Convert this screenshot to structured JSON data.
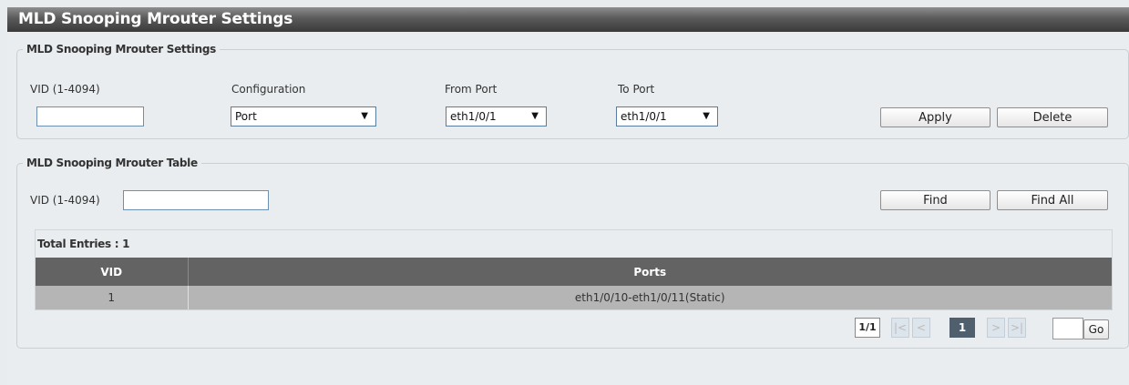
{
  "page": {
    "title": "MLD Snooping Mrouter Settings"
  },
  "settings": {
    "legend": "MLD Snooping Mrouter Settings",
    "vid_label": "VID (1-4094)",
    "vid_value": "",
    "configuration_label": "Configuration",
    "configuration_value": "Port",
    "from_port_label": "From Port",
    "from_port_value": "eth1/0/1",
    "to_port_label": "To Port",
    "to_port_value": "eth1/0/1",
    "apply_label": "Apply",
    "delete_label": "Delete"
  },
  "table_panel": {
    "legend": "MLD Snooping Mrouter Table",
    "vid_label": "VID (1-4094)",
    "vid_value": "",
    "find_label": "Find",
    "find_all_label": "Find All",
    "total_entries": "Total Entries : 1",
    "columns": {
      "vid": "VID",
      "ports": "Ports"
    },
    "rows": [
      {
        "vid": "1",
        "ports": "eth1/0/10-eth1/0/11(Static)"
      }
    ]
  },
  "pagination": {
    "page_info": "1/1",
    "first": "|<",
    "prev": "<",
    "current": "1",
    "next": ">",
    "last": ">|",
    "goto_value": "",
    "go_label": "Go"
  },
  "icons": {
    "dropdown": "triangle-down-icon"
  },
  "colors": {
    "title_bar": "#4a4a4a",
    "table_header": "#636363",
    "table_row": "#b5b5b5",
    "current_page": "#4f5f6e"
  }
}
